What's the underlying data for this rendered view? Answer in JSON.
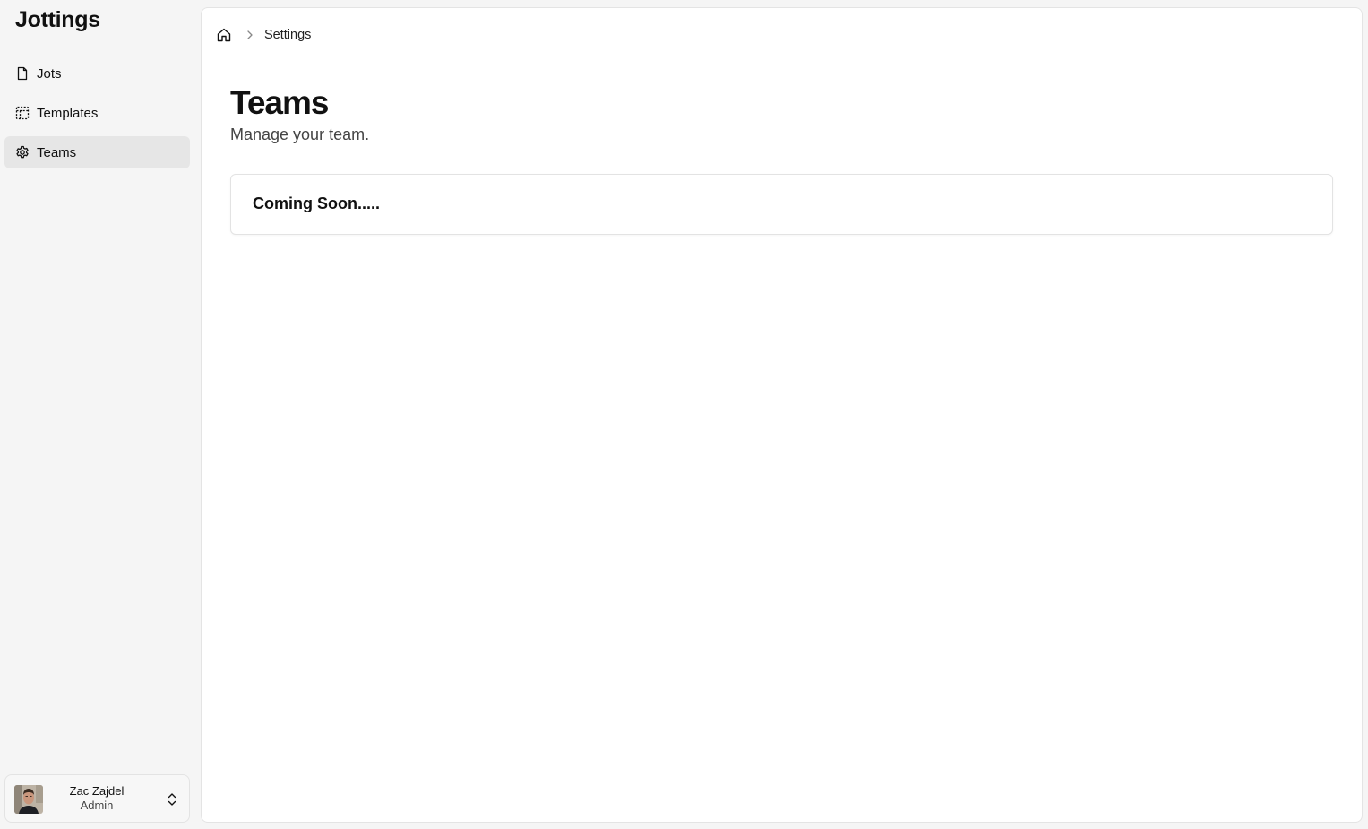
{
  "app": {
    "title": "Jottings"
  },
  "sidebar": {
    "items": [
      {
        "label": "Jots",
        "icon": "file-icon",
        "active": false
      },
      {
        "label": "Templates",
        "icon": "dashed-layout-icon",
        "active": false
      },
      {
        "label": "Teams",
        "icon": "gear-icon",
        "active": true
      }
    ]
  },
  "user": {
    "name": "Zac Zajdel",
    "role": "Admin"
  },
  "breadcrumb": {
    "home_icon": "home-icon",
    "current": "Settings"
  },
  "page": {
    "title": "Teams",
    "subtitle": "Manage your team."
  },
  "card": {
    "text": "Coming Soon....."
  },
  "colors": {
    "sidebar_bg": "#f5f5f5",
    "active_item_bg": "#e6e6e6",
    "main_bg": "#ffffff",
    "border": "#e4e4e4"
  }
}
